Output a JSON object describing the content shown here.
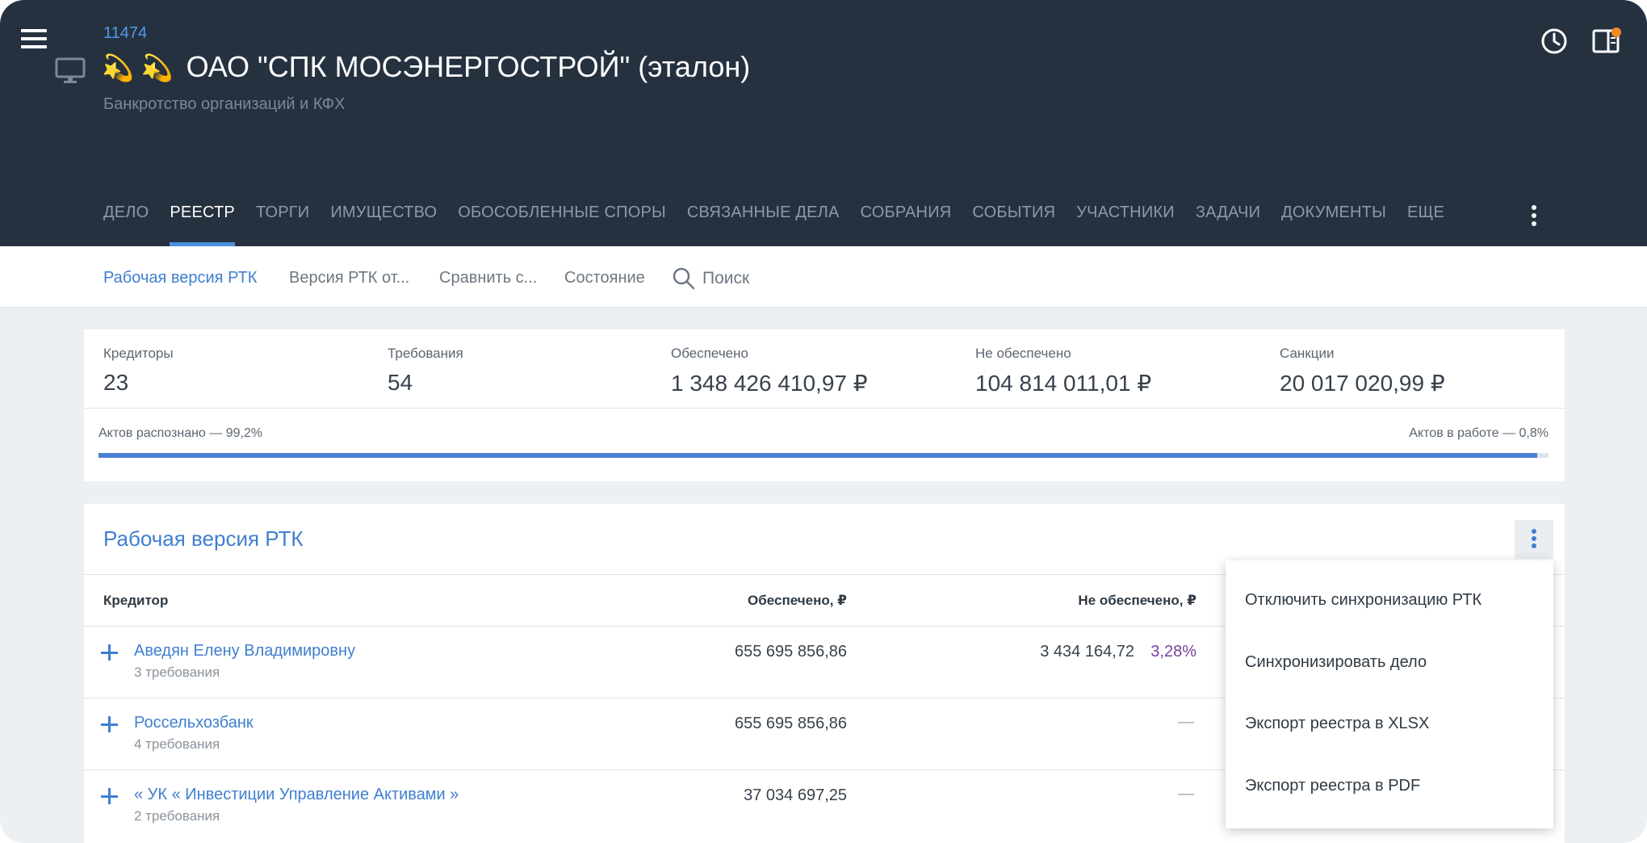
{
  "header": {
    "case_id": "11474",
    "emoji": "💫 💫",
    "title": "ОАО \"СПК МОСЭНЕРГОСТРОЙ\" (эталон)",
    "subtitle": "Банкротство организаций и КФХ"
  },
  "tabs": [
    "ДЕЛО",
    "РЕЕСТР",
    "ТОРГИ",
    "ИМУЩЕСТВО",
    "ОБОСОБЛЕННЫЕ СПОРЫ",
    "СВЯЗАННЫЕ ДЕЛА",
    "СОБРАНИЯ",
    "СОБЫТИЯ",
    "УЧАСТНИКИ",
    "ЗАДАЧИ",
    "ДОКУМЕНТЫ",
    "ЕЩЕ"
  ],
  "active_tab": "РЕЕСТР",
  "subnav": {
    "working_version": "Рабочая версия РТК",
    "version_from": "Версия РТК от...",
    "compare": "Сравнить с...",
    "state": "Состояние",
    "search_placeholder": "Поиск"
  },
  "stats": {
    "creditors": {
      "label": "Кредиторы",
      "value": "23"
    },
    "claims": {
      "label": "Требования",
      "value": "54"
    },
    "secured": {
      "label": "Обеспечено",
      "value": "1 348 426 410,97 ₽"
    },
    "unsecured": {
      "label": "Не обеспечено",
      "value": "104 814 011,01 ₽"
    },
    "sanctions": {
      "label": "Санкции",
      "value": "20 017 020,99 ₽"
    }
  },
  "progress": {
    "recognized_label": "Актов распознано — 99,2%",
    "in_work_label": "Актов в работе — 0,8%",
    "recognized_percent": 99.2
  },
  "registry": {
    "title": "Рабочая версия РТК",
    "columns": {
      "creditor": "Кредитор",
      "secured": "Обеспечено, ₽",
      "unsecured": "Не обеспечено, ₽"
    },
    "rows": [
      {
        "name": "Аведян Елену Владимировну",
        "claims": "3 требования",
        "secured": "655 695 856,86",
        "unsecured": "3 434 164,72",
        "unsecured_pct": "3,28%"
      },
      {
        "name": "Россельхозбанк",
        "claims": "4 требования",
        "secured": "655 695 856,86",
        "unsecured": "—",
        "unsecured_pct": ""
      },
      {
        "name": "« УК « Инвестиции Управление Активами »",
        "claims": "2 требования",
        "secured": "37 034 697,25",
        "unsecured": "—",
        "unsecured_pct": ""
      }
    ]
  },
  "menu": {
    "items": [
      "Отключить синхронизацию РТК",
      "Синхронизировать дело",
      "Экспорт реестра в XLSX",
      "Экспорт реестра в PDF"
    ]
  },
  "colors": {
    "header_bg": "#263140",
    "accent": "#3f7fcf",
    "notification": "#f08a24",
    "percent": "#7a3fa0"
  }
}
